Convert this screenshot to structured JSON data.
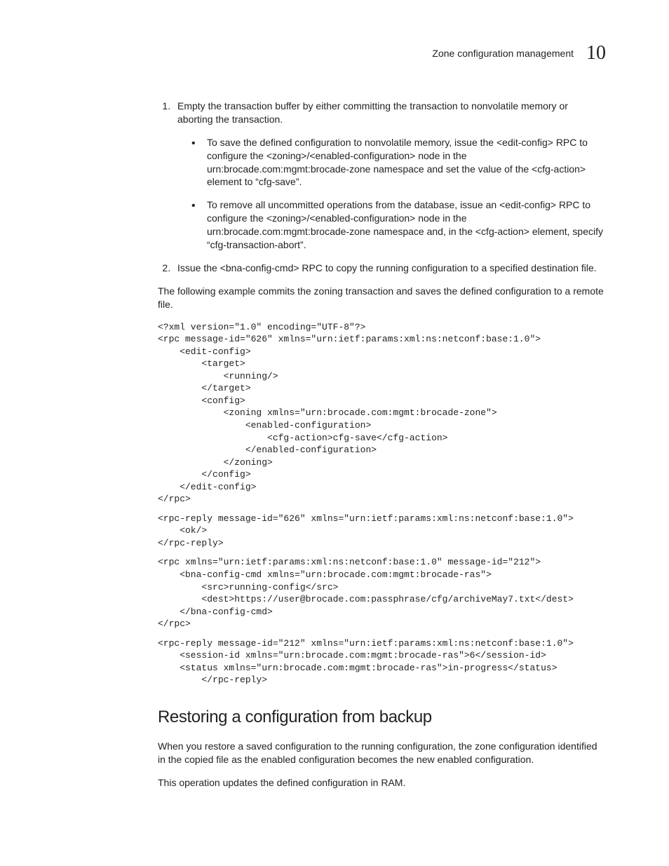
{
  "header": {
    "title": "Zone configuration management",
    "chapter_number": "10"
  },
  "step1_text": "Empty the transaction buffer by either committing the transaction to nonvolatile memory or aborting the transaction.",
  "step1_bullet1": "To save the defined configuration to nonvolatile memory, issue the <edit-config> RPC to configure the <zoning>/<enabled-configuration> node in the urn:brocade.com:mgmt:brocade-zone namespace and set the value of the <cfg-action> element to “cfg-save”.",
  "step1_bullet2": "To remove all uncommitted operations from the database, issue an <edit-config> RPC to configure the <zoning>/<enabled-configuration> node in the urn:brocade.com:mgmt:brocade-zone namespace and, in the <cfg-action> element, specify “cfg-transaction-abort”.",
  "step2_text": "Issue the <bna-config-cmd> RPC to copy the running configuration to a specified destination file.",
  "para_before_code": "The following example commits the zoning transaction and saves the defined configuration to a remote file.",
  "code_block1": "<?xml version=\"1.0\" encoding=\"UTF-8\"?>\n<rpc message-id=\"626\" xmlns=\"urn:ietf:params:xml:ns:netconf:base:1.0\">\n    <edit-config>\n        <target>\n            <running/>\n        </target>\n        <config>\n            <zoning xmlns=\"urn:brocade.com:mgmt:brocade-zone\">\n                <enabled-configuration>\n                    <cfg-action>cfg-save</cfg-action>\n                </enabled-configuration>\n            </zoning>\n        </config>\n    </edit-config>\n</rpc>",
  "code_block2": "<rpc-reply message-id=\"626\" xmlns=\"urn:ietf:params:xml:ns:netconf:base:1.0\">\n    <ok/>\n</rpc-reply>",
  "code_block3": "<rpc xmlns=\"urn:ietf:params:xml:ns:netconf:base:1.0\" message-id=\"212\">\n    <bna-config-cmd xmlns=\"urn:brocade.com:mgmt:brocade-ras\">\n        <src>running-config</src>\n        <dest>https://user@brocade.com:passphrase/cfg/archiveMay7.txt</dest>\n    </bna-config-cmd>\n</rpc>",
  "code_block4": "<rpc-reply message-id=\"212\" xmlns=\"urn:ietf:params:xml:ns:netconf:base:1.0\">\n    <session-id xmlns=\"urn:brocade.com:mgmt:brocade-ras\">6</session-id>\n    <status xmlns=\"urn:brocade.com:mgmt:brocade-ras\">in-progress</status>\n        </rpc-reply>",
  "section_heading": "Restoring a configuration from backup",
  "section_para1": "When you restore a saved configuration to the running configuration, the zone configuration identified in the copied file as the enabled configuration becomes the new enabled configuration.",
  "section_para2": "This operation updates the defined configuration in RAM."
}
